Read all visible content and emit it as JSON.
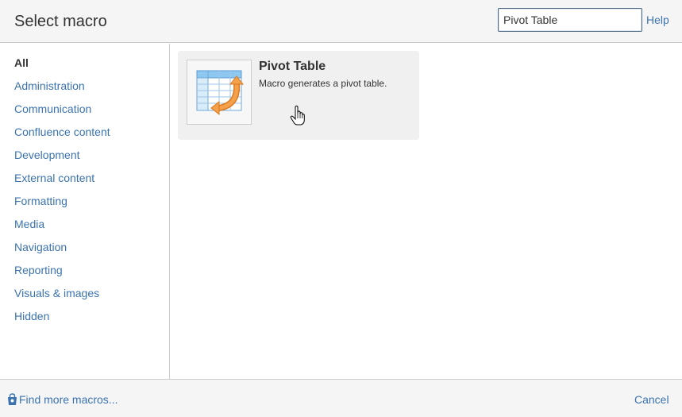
{
  "header": {
    "title": "Select macro",
    "search_value": "Pivot Table",
    "help_label": "Help"
  },
  "sidebar": {
    "categories": [
      {
        "label": "All",
        "active": true
      },
      {
        "label": "Administration"
      },
      {
        "label": "Communication"
      },
      {
        "label": "Confluence content"
      },
      {
        "label": "Development"
      },
      {
        "label": "External content"
      },
      {
        "label": "Formatting"
      },
      {
        "label": "Media"
      },
      {
        "label": "Navigation"
      },
      {
        "label": "Reporting"
      },
      {
        "label": "Visuals & images"
      },
      {
        "label": "Hidden"
      }
    ]
  },
  "results": [
    {
      "name": "Pivot Table",
      "description": "Macro generates a pivot table.",
      "icon": "pivot-table-icon"
    }
  ],
  "footer": {
    "find_more_label": "Find more macros...",
    "cancel_label": "Cancel"
  },
  "colors": {
    "link": "#3b73af",
    "text": "#333333",
    "panel_bg": "#f5f5f5",
    "card_bg": "#f0f0f0",
    "border": "#cccccc",
    "icon_orange": "#f0932b",
    "icon_blue": "#8ec8f0"
  }
}
